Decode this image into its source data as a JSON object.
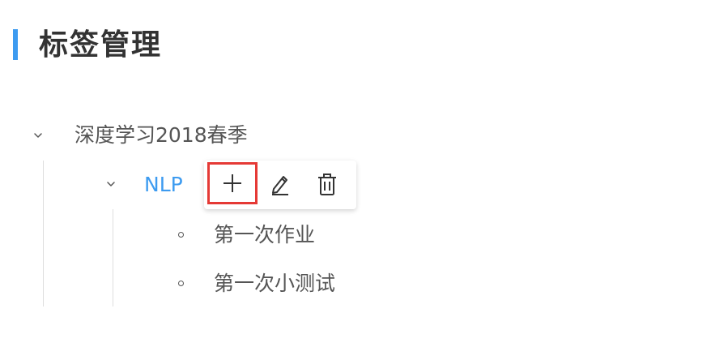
{
  "page": {
    "title": "标签管理"
  },
  "tree": {
    "root": {
      "label": "深度学习2018春季",
      "expanded": true,
      "children": [
        {
          "label": "NLP",
          "expanded": true,
          "active": true,
          "children": [
            {
              "label": "第一次作业"
            },
            {
              "label": "第一次小测试"
            }
          ]
        }
      ]
    }
  },
  "toolbar": {
    "buttons": [
      {
        "icon": "plus-icon",
        "highlighted": true
      },
      {
        "icon": "pencil-icon",
        "highlighted": false
      },
      {
        "icon": "trash-icon",
        "highlighted": false
      }
    ]
  },
  "colors": {
    "accent": "#3d9bf0",
    "highlight_border": "#e53935",
    "text": "#555555",
    "title": "#333333"
  }
}
